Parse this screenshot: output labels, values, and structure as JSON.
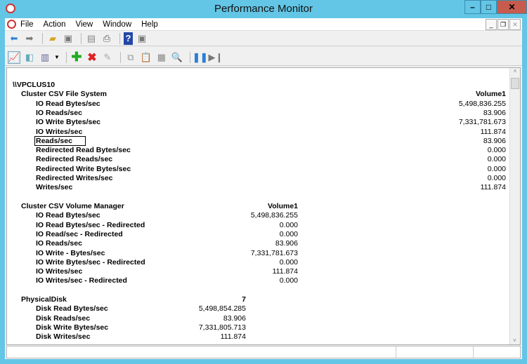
{
  "window": {
    "title": "Performance Monitor"
  },
  "menu": [
    "File",
    "Action",
    "View",
    "Window",
    "Help"
  ],
  "sections": [
    {
      "host": "\\\\VPCLUS10",
      "object": "Cluster CSV File System",
      "instance": "Volume1",
      "counters": [
        [
          "IO Read Bytes/sec",
          "5,498,836.255"
        ],
        [
          "IO Reads/sec",
          "83.906"
        ],
        [
          "IO Write Bytes/sec",
          "7,331,781.673"
        ],
        [
          "IO Writes/sec",
          "111.874"
        ],
        [
          "Reads/sec",
          "83.906"
        ],
        [
          "Redirected Read Bytes/sec",
          "0.000"
        ],
        [
          "Redirected Reads/sec",
          "0.000"
        ],
        [
          "Redirected Write Bytes/sec",
          "0.000"
        ],
        [
          "Redirected Writes/sec",
          "0.000"
        ],
        [
          "Writes/sec",
          "111.874"
        ]
      ]
    },
    {
      "object": "Cluster CSV Volume Manager",
      "instance": "Volume1",
      "counters": [
        [
          "IO Read Bytes/sec",
          "5,498,836.255"
        ],
        [
          "IO Read Bytes/sec - Redirected",
          "0.000"
        ],
        [
          "IO Read/sec - Redirected",
          "0.000"
        ],
        [
          "IO Reads/sec",
          "83.906"
        ],
        [
          "IO Write - Bytes/sec",
          "7,331,781.673"
        ],
        [
          "IO Write Bytes/sec - Redirected",
          "0.000"
        ],
        [
          "IO Writes/sec",
          "111.874"
        ],
        [
          "IO Writes/sec - Redirected",
          "0.000"
        ]
      ]
    },
    {
      "object": "PhysicalDisk",
      "instance": "7",
      "counters": [
        [
          "Disk Read Bytes/sec",
          "5,498,854.285"
        ],
        [
          "Disk Reads/sec",
          "83.906"
        ],
        [
          "Disk Write Bytes/sec",
          "7,331,805.713"
        ],
        [
          "Disk Writes/sec",
          "111.874"
        ]
      ]
    }
  ],
  "selected_counter": "Reads/sec"
}
